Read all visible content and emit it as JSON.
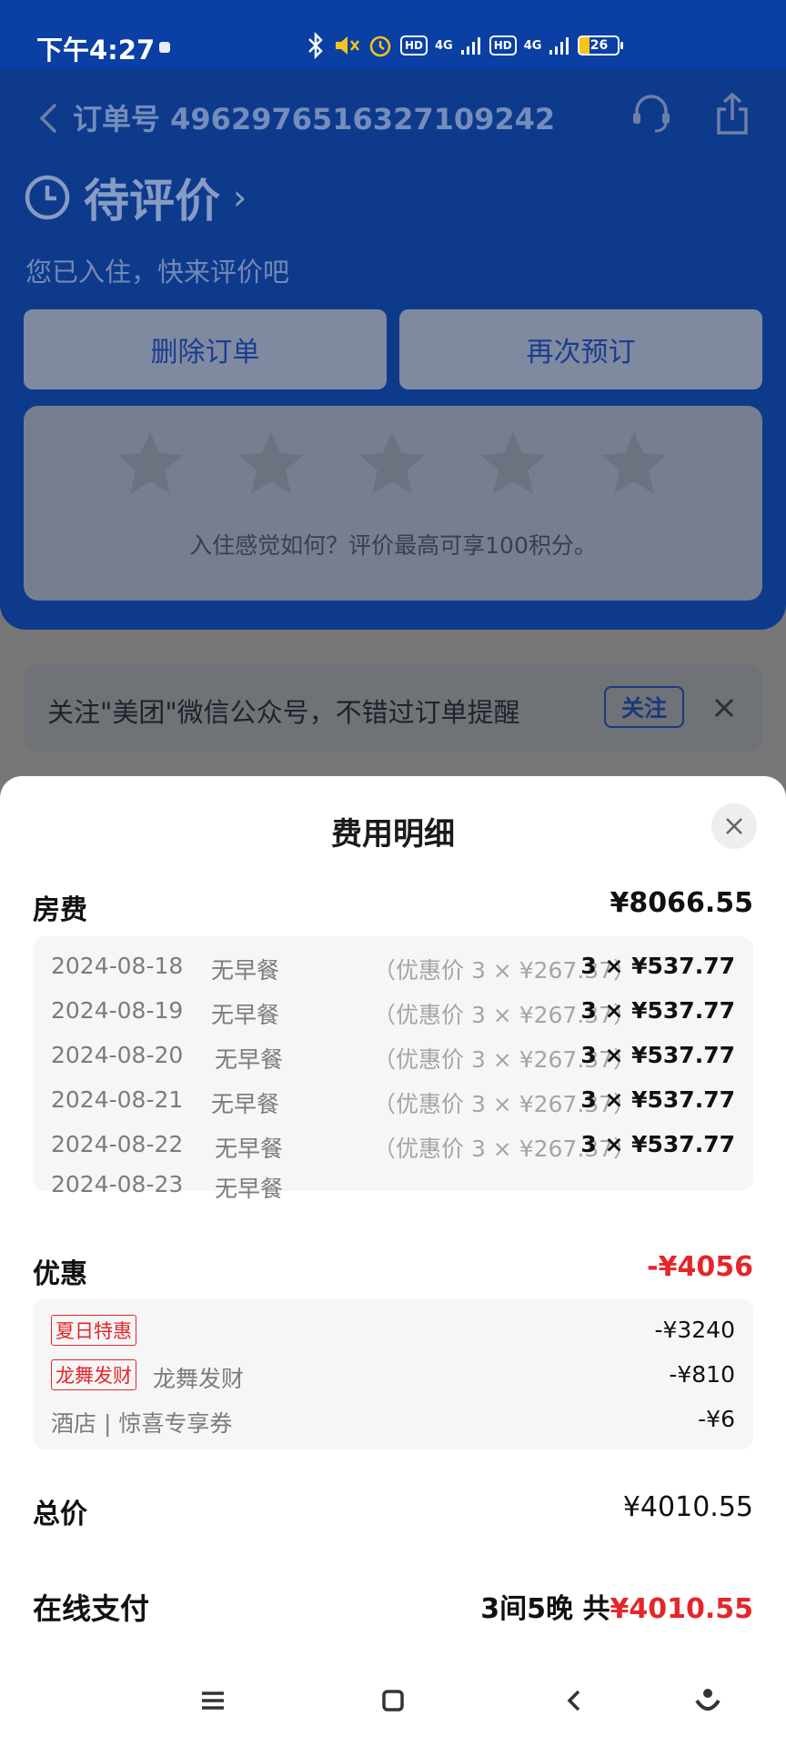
{
  "status_bar": {
    "time": "下午4:27",
    "signal_1": "4G",
    "signal_2": "4G",
    "hd_1": "HD",
    "hd_2": "HD",
    "battery": "26",
    "battery_level_percent": 26,
    "battery_color": "#f5c518"
  },
  "header": {
    "order_number": "订单号 4962976516327109242",
    "status_title": "待评价",
    "status_subtitle": "您已入住，快来评价吧",
    "buttons": {
      "delete": "删除订单",
      "rebook": "再次预订"
    },
    "rating_hint": "入住感觉如何？评价最高可享100积分。",
    "stars_count": 5,
    "accent_color": "#0a3fa3"
  },
  "follow_bar": {
    "text": "关注\"美团\"微信公众号，不错过订单提醒",
    "button": "关注"
  },
  "sheet": {
    "title": "费用明细",
    "room": {
      "label": "房费",
      "amount": "¥8066.55",
      "nights": [
        {
          "date": "2024-08-18",
          "meal": "无早餐",
          "discount": "（优惠价 3 × ¥267.37）",
          "price": "3 × ¥537.77"
        },
        {
          "date": "2024-08-19",
          "meal": "无早餐",
          "discount": "（优惠价 3 × ¥267.37）",
          "price": "3 × ¥537.77"
        },
        {
          "date": "2024-08-20",
          "meal": "无早餐",
          "discount": "（优惠价 3 × ¥267.37）",
          "price": "3 × ¥537.77"
        },
        {
          "date": "2024-08-21",
          "meal": "无早餐",
          "discount": "（优惠价 3 × ¥267.37）",
          "price": "3 × ¥537.77"
        },
        {
          "date": "2024-08-22",
          "meal": "无早餐",
          "discount": "（优惠价 3 × ¥267.37）",
          "price": "3 × ¥537.77"
        },
        {
          "date": "2024-08-23",
          "meal": "无早餐",
          "discount": "",
          "price": ""
        }
      ]
    },
    "discount": {
      "label": "优惠",
      "amount": "-¥4056",
      "items": [
        {
          "tag": "夏日特惠",
          "name": "",
          "amount": "-¥3240"
        },
        {
          "tag": "龙舞发财",
          "name": "龙舞发财",
          "amount": "-¥810"
        },
        {
          "tag": "",
          "name": "酒店 | 惊喜专享券",
          "amount": "-¥6"
        }
      ]
    },
    "total": {
      "label": "总价",
      "amount": "¥4010.55"
    },
    "payment": {
      "label": "在线支付",
      "summary": "3间5晚 共",
      "amount": "¥4010.55"
    },
    "red_color": "#e4262b"
  }
}
